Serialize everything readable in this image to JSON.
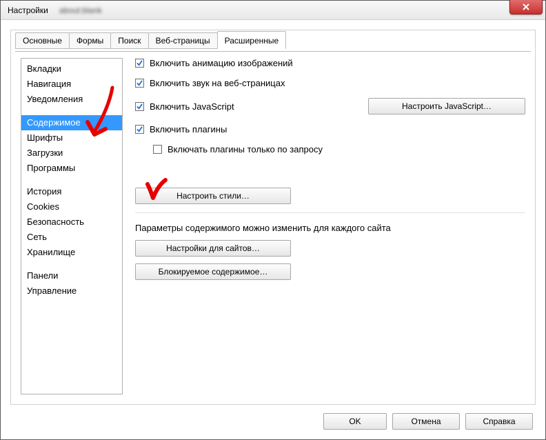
{
  "window": {
    "title": "Настройки"
  },
  "tabs": [
    {
      "label": "Основные",
      "active": false
    },
    {
      "label": "Формы",
      "active": false
    },
    {
      "label": "Поиск",
      "active": false
    },
    {
      "label": "Веб-страницы",
      "active": false
    },
    {
      "label": "Расширенные",
      "active": true
    }
  ],
  "sidebar": {
    "groups": [
      {
        "items": [
          "Вкладки",
          "Навигация",
          "Уведомления"
        ]
      },
      {
        "items": [
          "Содержимое",
          "Шрифты",
          "Загрузки",
          "Программы"
        ],
        "selected_index": 0
      },
      {
        "items": [
          "История",
          "Cookies",
          "Безопасность",
          "Сеть",
          "Хранилище"
        ]
      },
      {
        "items": [
          "Панели",
          "Управление"
        ]
      }
    ]
  },
  "content": {
    "checkboxes": {
      "anim": {
        "label": "Включить анимацию изображений",
        "checked": true
      },
      "sound": {
        "label": "Включить звук на веб-страницах",
        "checked": true
      },
      "js": {
        "label": "Включить JavaScript",
        "checked": true
      },
      "plugins": {
        "label": "Включить плагины",
        "checked": true
      },
      "plugins_ondemand": {
        "label": "Включать плагины только по запросу",
        "checked": false
      }
    },
    "buttons": {
      "config_js": "Настроить JavaScript…",
      "config_styles": "Настроить стили…",
      "site_settings": "Настройки для сайтов…",
      "blocked_content": "Блокируемое содержимое…"
    },
    "site_params_text": "Параметры содержимого можно изменить для каждого сайта"
  },
  "footer": {
    "ok": "OK",
    "cancel": "Отмена",
    "help": "Справка"
  }
}
